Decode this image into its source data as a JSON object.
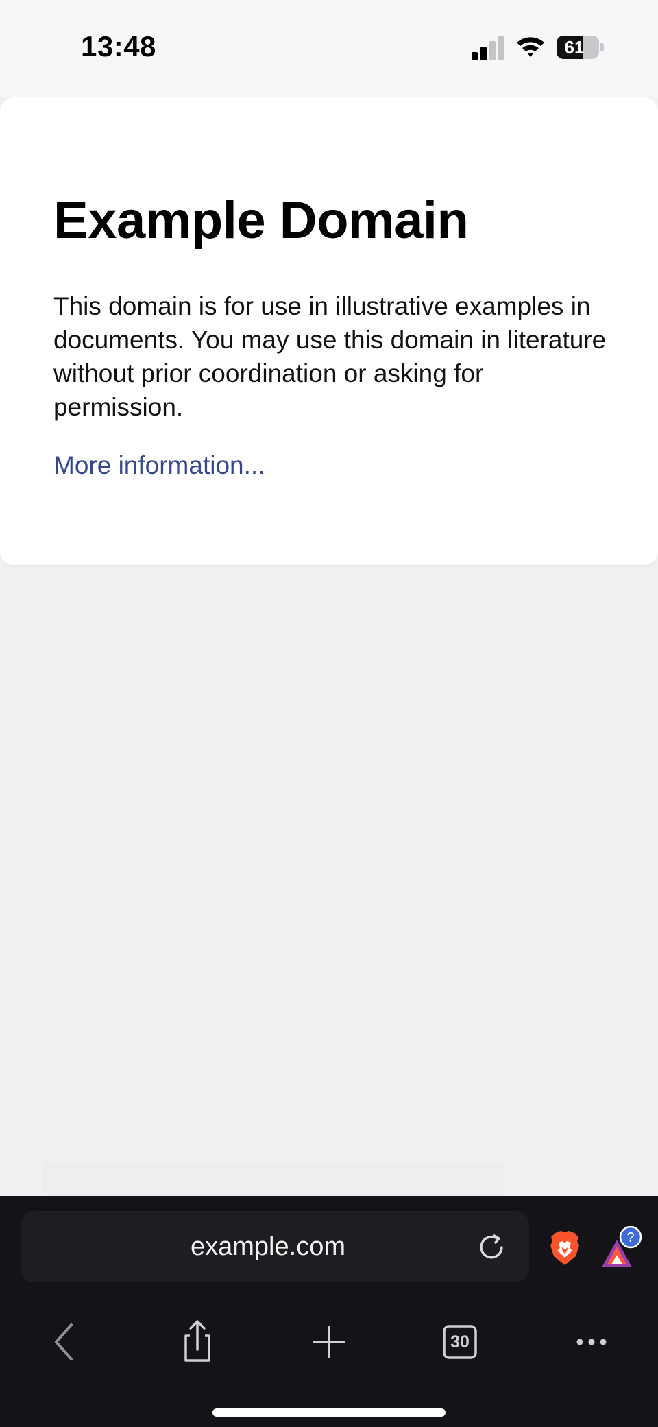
{
  "status_bar": {
    "time": "13:48",
    "battery_level": "61",
    "battery_fraction": 0.61,
    "icons": [
      "signal-icon",
      "wifi-icon",
      "battery-icon"
    ]
  },
  "page": {
    "heading": "Example Domain",
    "paragraph": "This domain is for use in illustrative examples in documents. You may use this domain in literature without prior coordination or asking for permission.",
    "link_text": "More information...",
    "link_color": "#38488f"
  },
  "toolbar": {
    "url": "example.com",
    "tabs_count": "30",
    "icons": [
      "reload-icon",
      "brave-shield-icon",
      "brave-rewards-icon",
      "back-icon",
      "share-icon",
      "new-tab-icon",
      "tabs-icon",
      "more-icon"
    ],
    "background_color": "#141418",
    "brave_orange": "#fb542b",
    "rewards_badge_color": "#3f6ad8"
  }
}
